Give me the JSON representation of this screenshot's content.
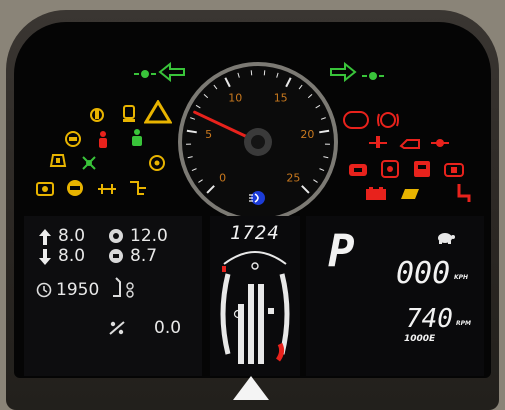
{
  "colors": {
    "amber": "#e8b400",
    "red": "#e8221c",
    "green": "#39c43a",
    "gauge_orange": "#c8781e",
    "white": "#f2f2f2"
  },
  "icons": {
    "left_indicator": "turn-left-arrow-icon",
    "right_indicator": "turn-right-arrow-icon",
    "left_beam": "parking-light-icon",
    "right_beam": "parking-light-icon",
    "headlamp": "high-beam-icon"
  },
  "tach_gauge": {
    "ticks": [
      "0",
      "5",
      "10",
      "15",
      "20",
      "25"
    ],
    "needle_value": 6.5,
    "max": 25
  },
  "left_readouts": {
    "r1c1": "8.0",
    "r1c2": "12.0",
    "r2c1": "8.0",
    "r2c2": "8.7",
    "r3c1": "1950",
    "r4c2": "0.0"
  },
  "center_display": {
    "counter": "1724"
  },
  "right_display": {
    "gear": "P",
    "speed": "000",
    "speed_unit": "KPH",
    "rpm": "740",
    "rpm_unit": "RPM",
    "mode": "1000E"
  }
}
